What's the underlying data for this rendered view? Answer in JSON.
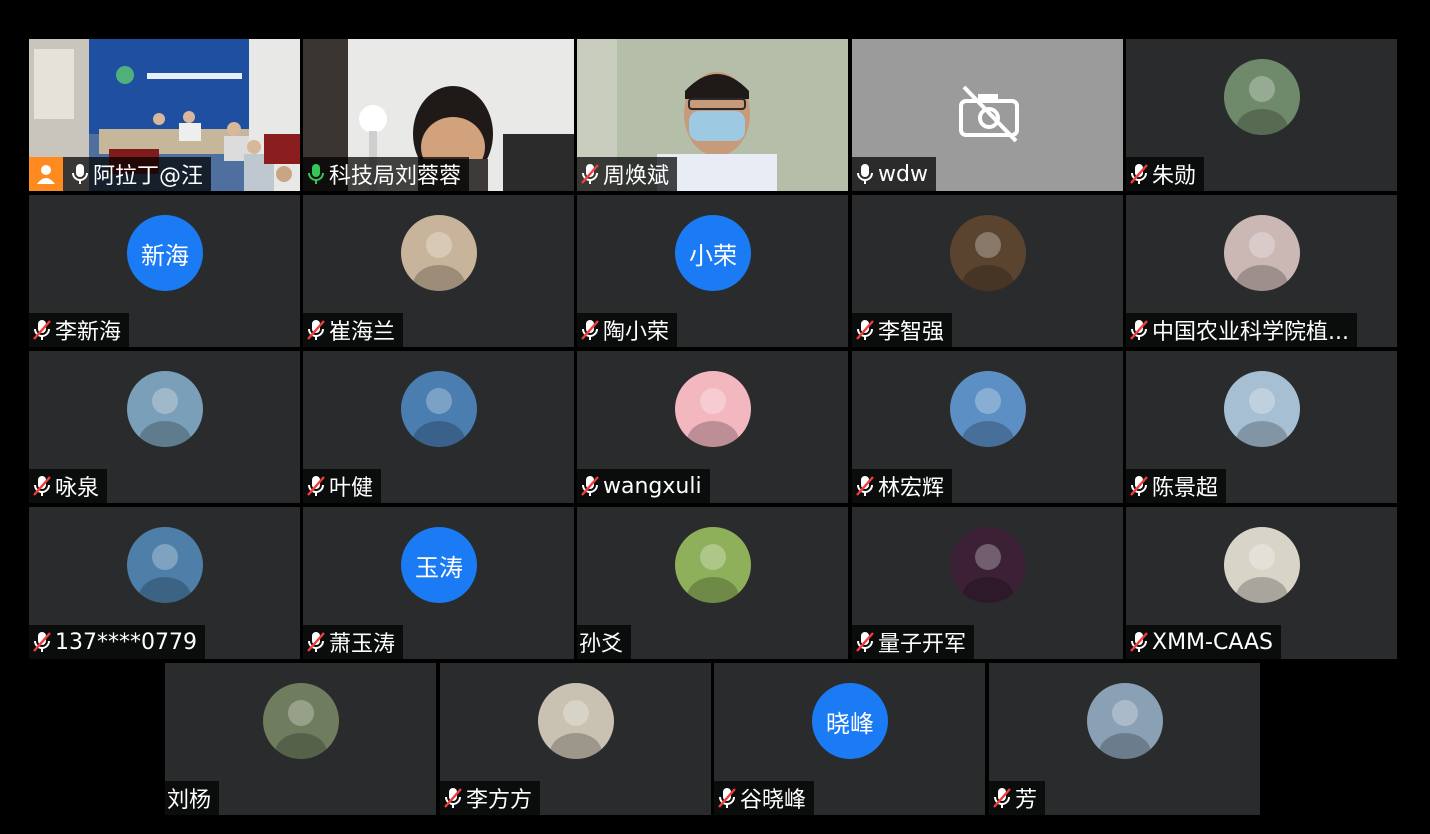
{
  "meeting": {
    "participants": [
      {
        "name": "阿拉丁@汪",
        "mic": "on",
        "kind": "video-room",
        "host": true
      },
      {
        "name": "科技局刘蓉蓉",
        "mic": "on-green",
        "kind": "video-person",
        "active": true
      },
      {
        "name": "周焕斌",
        "mic": "muted",
        "kind": "video-mask"
      },
      {
        "name": "wdw",
        "mic": "on",
        "kind": "camera-off"
      },
      {
        "name": "朱勋",
        "mic": "muted",
        "kind": "photo",
        "color": "#6f8a6a"
      },
      {
        "name": "李新海",
        "mic": "muted",
        "kind": "initials",
        "initials": "新海"
      },
      {
        "name": "崔海兰",
        "mic": "muted",
        "kind": "photo",
        "color": "#c8b49a"
      },
      {
        "name": "陶小荣",
        "mic": "muted",
        "kind": "initials",
        "initials": "小荣"
      },
      {
        "name": "李智强",
        "mic": "muted",
        "kind": "photo",
        "color": "#5a4430"
      },
      {
        "name": "中国农业科学院植...",
        "mic": "muted",
        "kind": "photo",
        "color": "#cbb8b4"
      },
      {
        "name": "咏泉",
        "mic": "muted",
        "kind": "photo",
        "color": "#7a9fb8"
      },
      {
        "name": "叶健",
        "mic": "muted",
        "kind": "photo",
        "color": "#4a7db0"
      },
      {
        "name": "wangxuli",
        "mic": "muted",
        "kind": "photo",
        "color": "#f3b7c0"
      },
      {
        "name": "林宏辉",
        "mic": "muted",
        "kind": "photo",
        "color": "#5c8fc4"
      },
      {
        "name": "陈景超",
        "mic": "muted",
        "kind": "photo",
        "color": "#a7bfd3"
      },
      {
        "name": "137****0779",
        "mic": "muted",
        "kind": "photo",
        "color": "#4e7fa8"
      },
      {
        "name": "萧玉涛",
        "mic": "muted",
        "kind": "initials",
        "initials": "玉涛"
      },
      {
        "name": "孙爻",
        "mic": "none",
        "kind": "photo",
        "color": "#8fb05a"
      },
      {
        "name": "量子开军",
        "mic": "muted",
        "kind": "photo",
        "color": "#3b2036"
      },
      {
        "name": "XMM-CAAS",
        "mic": "muted",
        "kind": "photo",
        "color": "#d9d4c8"
      },
      {
        "name": "刘杨",
        "mic": "none",
        "kind": "photo",
        "color": "#6f7d5e"
      },
      {
        "name": "李方方",
        "mic": "muted",
        "kind": "photo",
        "color": "#c9c2b2"
      },
      {
        "name": "谷晓峰",
        "mic": "muted",
        "kind": "initials",
        "initials": "晓峰"
      },
      {
        "name": "芳",
        "mic": "muted",
        "kind": "photo",
        "color": "#8aa0b5"
      }
    ]
  }
}
